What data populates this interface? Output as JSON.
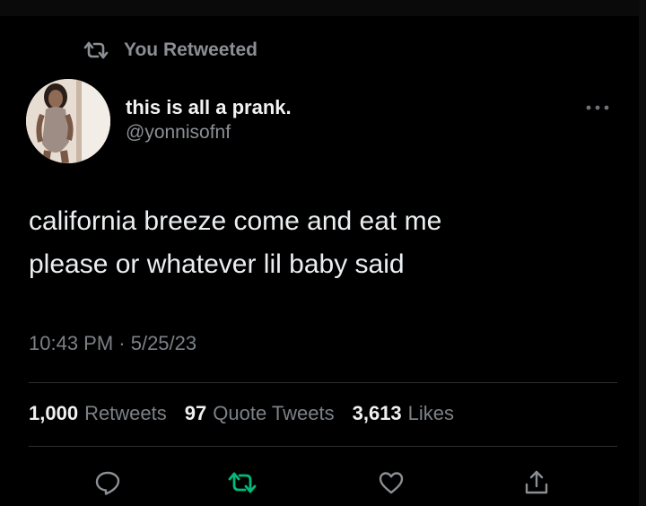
{
  "context": {
    "label": "You Retweeted",
    "icon": "retweet-icon"
  },
  "author": {
    "display_name": "this is all a prank.",
    "handle": "@yonnisofnf",
    "avatar": "profile-photo"
  },
  "more_icon": "more-icon",
  "tweet": {
    "text": "california breeze come and eat me\nplease or whatever lil baby said",
    "timestamp": "10:43 PM · 5/25/23"
  },
  "stats": [
    {
      "count": "1,000",
      "label": "Retweets"
    },
    {
      "count": "97",
      "label": "Quote Tweets"
    },
    {
      "count": "3,613",
      "label": "Likes"
    }
  ],
  "actions": [
    {
      "name": "reply",
      "icon": "reply-icon"
    },
    {
      "name": "retweet",
      "icon": "retweet-icon",
      "active": true
    },
    {
      "name": "like",
      "icon": "heart-icon"
    },
    {
      "name": "share",
      "icon": "share-icon"
    }
  ],
  "colors": {
    "background": "#000000",
    "text_primary": "#e7e9ea",
    "text_secondary": "#8b8f94",
    "retweet_active": "#00ba7c",
    "divider": "#2b2f33"
  }
}
